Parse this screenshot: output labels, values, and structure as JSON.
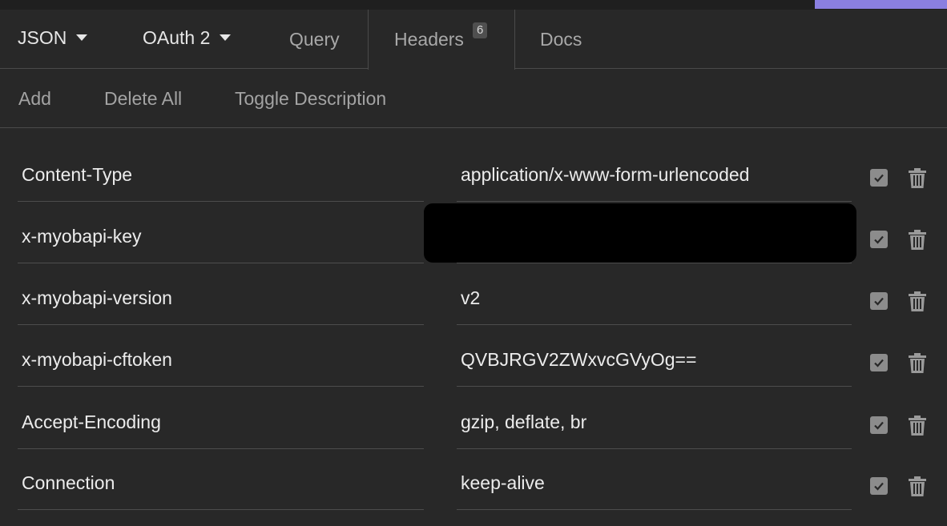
{
  "tabs": {
    "json": "JSON",
    "oauth": "OAuth 2",
    "query": "Query",
    "headers": "Headers",
    "headers_count": "6",
    "docs": "Docs"
  },
  "toolbar": {
    "add": "Add",
    "delete_all": "Delete All",
    "toggle_description": "Toggle Description"
  },
  "headers": [
    {
      "name": "Content-Type",
      "value": "application/x-www-form-urlencoded",
      "enabled": true
    },
    {
      "name": "x-myobapi-key",
      "value": "",
      "enabled": true
    },
    {
      "name": "x-myobapi-version",
      "value": "v2",
      "enabled": true
    },
    {
      "name": "x-myobapi-cftoken",
      "value": "QVBJRGV2ZWxvcGVyOg==",
      "enabled": true
    },
    {
      "name": "Accept-Encoding",
      "value": "gzip, deflate, br",
      "enabled": true
    },
    {
      "name": "Connection",
      "value": "keep-alive",
      "enabled": true
    }
  ],
  "colors": {
    "background": "#282828",
    "accent": "#8a7fe0",
    "redaction": "#000000"
  },
  "icons": {
    "checkbox": "checkbox-checked-icon",
    "delete": "trash-icon",
    "dropdown": "caret-down-icon"
  }
}
